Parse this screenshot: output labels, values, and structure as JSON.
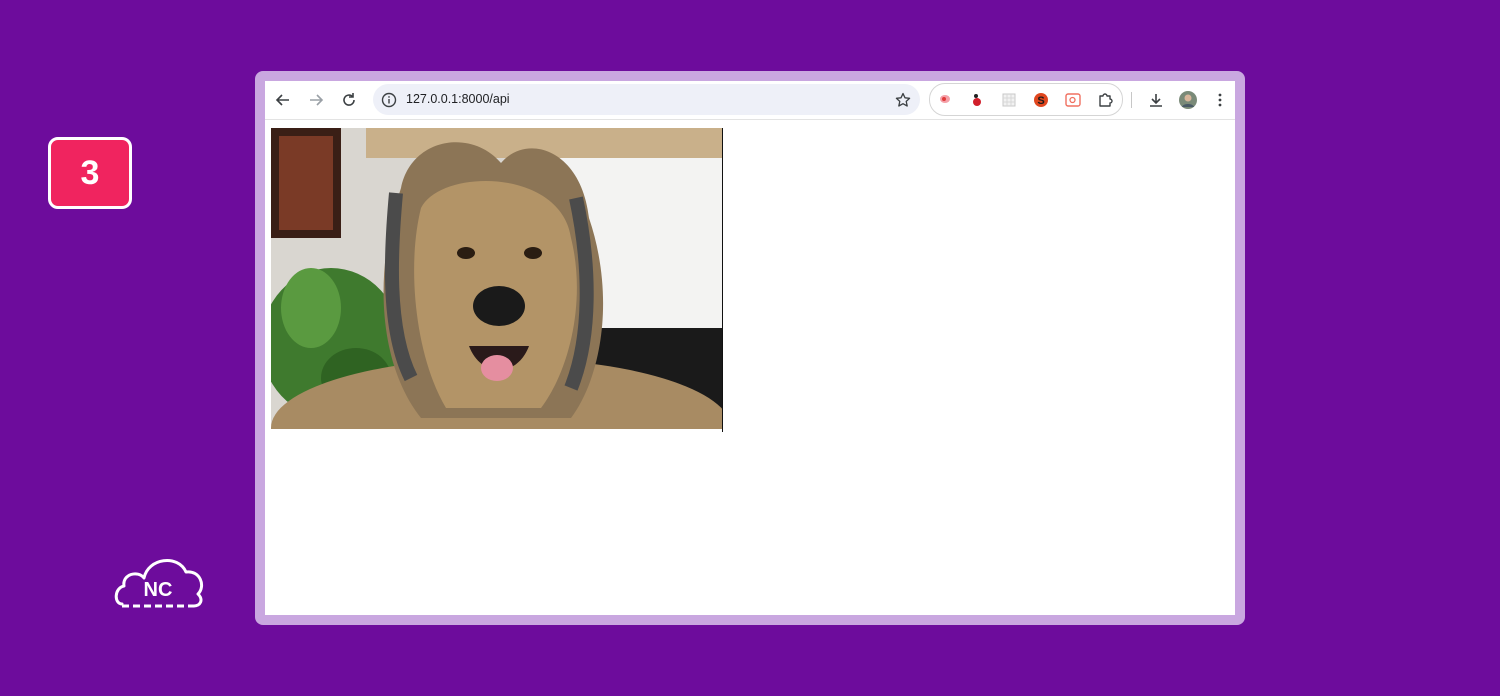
{
  "step": {
    "number": "3"
  },
  "logo": {
    "text": "NC"
  },
  "browser": {
    "address": "127.0.0.1:8000/api",
    "toolbar_icons": {
      "back": "arrow-left-icon",
      "forward": "arrow-right-icon",
      "reload": "reload-icon",
      "site_info": "info-icon",
      "bookmark": "star-icon",
      "extensions": "puzzle-icon",
      "downloads": "download-icon",
      "profile": "avatar",
      "menu": "kebab-menu-icon"
    }
  },
  "page": {
    "image": "dog-photo"
  },
  "colors": {
    "background": "#6d0c9c",
    "frame": "#c9a7e0",
    "badge": "#f0245f"
  }
}
